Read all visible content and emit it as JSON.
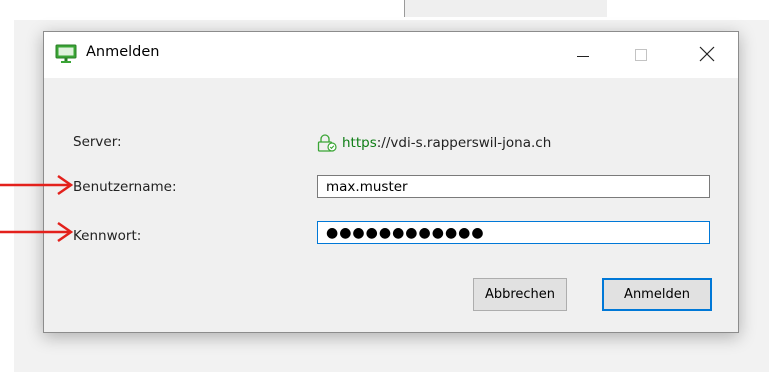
{
  "window": {
    "title": "Anmelden",
    "icon": "monitor-icon",
    "controls": [
      "minimize-icon",
      "maximize-icon",
      "close-icon"
    ]
  },
  "form": {
    "server_label": "Server:",
    "server_scheme": "https",
    "server_rest": "://vdi-s.rapperswil-jona.ch",
    "server_icon": "lock-icon",
    "username_label": "Benutzername:",
    "username_value": "max.muster",
    "password_label": "Kennwort:",
    "password_value": "●●●●●●●●●●●●"
  },
  "buttons": {
    "cancel": "Abbrechen",
    "login": "Anmelden"
  },
  "annotations": {
    "arrow_color": "#e3211c",
    "targets": [
      "username",
      "password"
    ]
  },
  "colors": {
    "accent": "#0078d7",
    "https": "#0d7d14",
    "icon_green": "#3aa535"
  }
}
